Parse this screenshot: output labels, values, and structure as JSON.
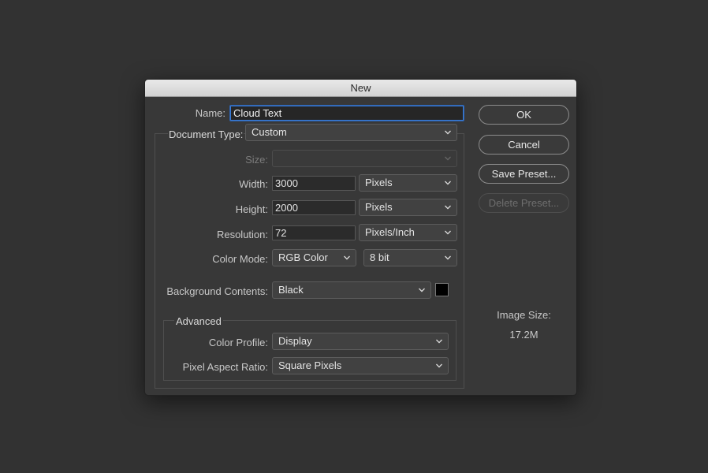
{
  "dialog": {
    "title": "New",
    "name": {
      "label": "Name:",
      "value": "Cloud Text"
    },
    "document_type": {
      "label": "Document Type:",
      "value": "Custom"
    },
    "size": {
      "label": "Size:",
      "value": ""
    },
    "width": {
      "label": "Width:",
      "value": "3000",
      "unit": "Pixels"
    },
    "height": {
      "label": "Height:",
      "value": "2000",
      "unit": "Pixels"
    },
    "resolution": {
      "label": "Resolution:",
      "value": "72",
      "unit": "Pixels/Inch"
    },
    "color_mode": {
      "label": "Color Mode:",
      "value": "RGB Color",
      "depth": "8 bit"
    },
    "background": {
      "label": "Background Contents:",
      "value": "Black",
      "swatch_color": "#000000"
    },
    "advanced": {
      "title": "Advanced",
      "color_profile": {
        "label": "Color Profile:",
        "value": "Display"
      },
      "pixel_aspect": {
        "label": "Pixel Aspect Ratio:",
        "value": "Square Pixels"
      }
    },
    "buttons": {
      "ok": "OK",
      "cancel": "Cancel",
      "save_preset": "Save Preset...",
      "delete_preset": "Delete Preset..."
    },
    "image_size": {
      "label": "Image Size:",
      "value": "17.2M"
    }
  },
  "colors": {
    "background": "#323232",
    "dialog": "#383838",
    "focus_ring": "#3a7bd5"
  }
}
